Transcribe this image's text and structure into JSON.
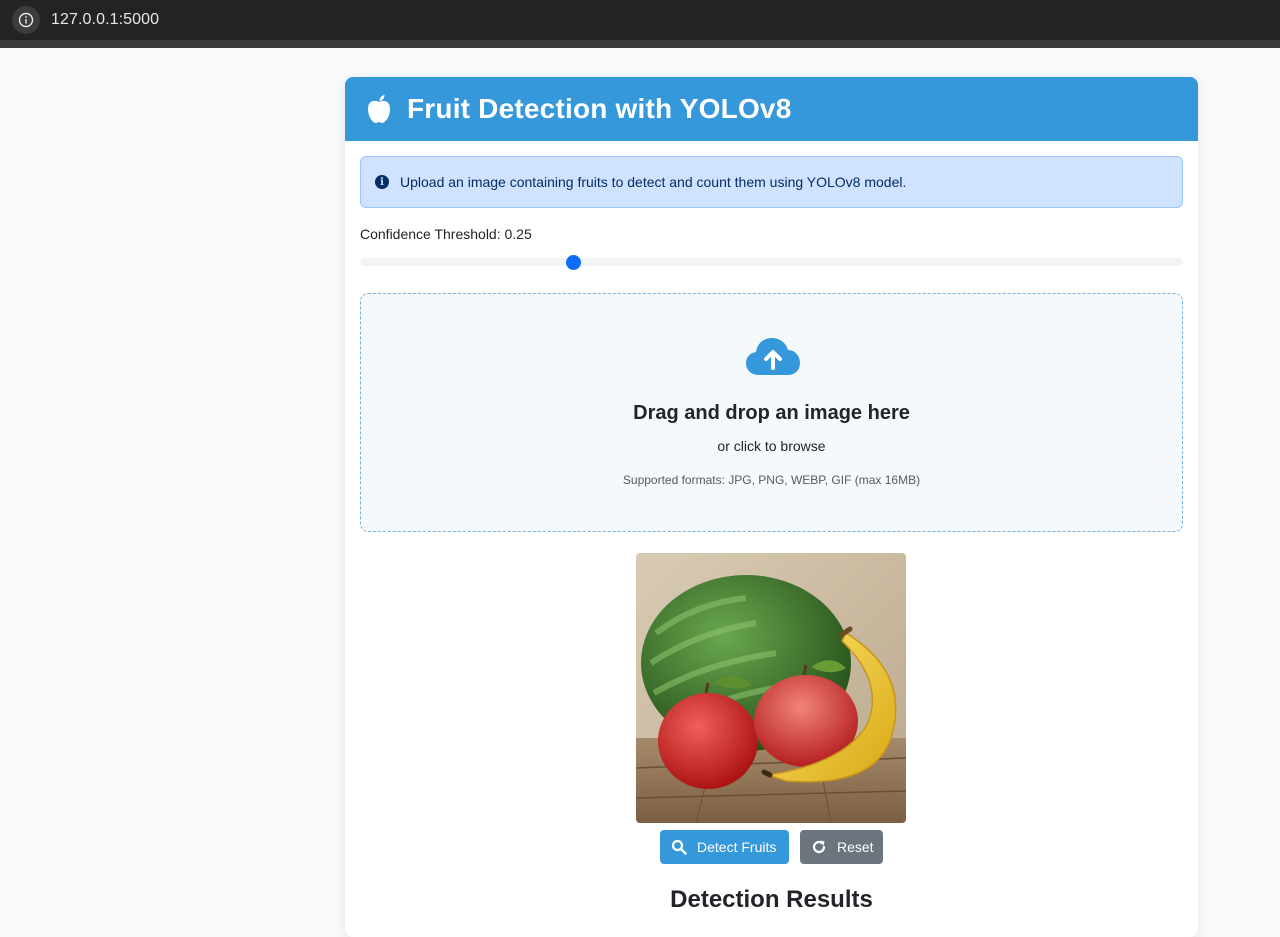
{
  "browser": {
    "url": "127.0.0.1:5000",
    "site_info_icon": "info-circle-icon"
  },
  "header": {
    "title": "Fruit Detection with YOLOv8",
    "icon": "apple-icon",
    "color": "#3498db"
  },
  "alert": {
    "icon": "info-circle-icon",
    "text": "Upload an image containing fruits to detect and count them using YOLOv8 model."
  },
  "threshold": {
    "label": "Confidence Threshold: 0.25",
    "value": 0.25,
    "min": 0,
    "max": 1,
    "accent": "#0d6efd"
  },
  "dropzone": {
    "icon": "cloud-upload-icon",
    "title": "Drag and drop an image here",
    "subtitle": "or click to browse",
    "formats": "Supported formats: JPG, PNG, WEBP, GIF (max 16MB)"
  },
  "preview": {
    "subject": "watermelon, two red apples and a banana on wooden table"
  },
  "buttons": {
    "detect_label": "Detect Fruits",
    "detect_icon": "search-icon",
    "reset_label": "Reset",
    "reset_icon": "redo-icon"
  },
  "results": {
    "heading": "Detection Results"
  }
}
